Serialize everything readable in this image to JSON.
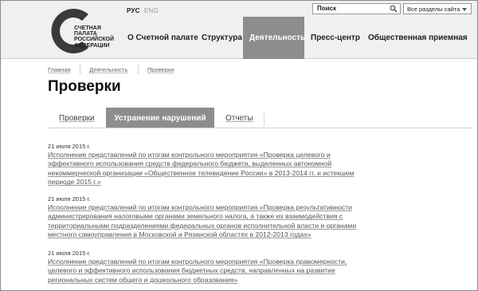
{
  "header": {
    "logo_lines": [
      "СЧЕТНАЯ",
      "ПАЛАТА",
      "РОССИЙСКОЙ",
      "ФЕДЕРАЦИИ"
    ],
    "languages": [
      {
        "label": "РУС",
        "active": true
      },
      {
        "label": "ENG",
        "active": false
      }
    ],
    "search": {
      "value": "Поиск",
      "icon": "search-icon"
    },
    "section_select": {
      "value": "Все разделы сайта",
      "icon": "chevron-down-icon"
    },
    "nav": [
      {
        "label": "О Счетной палате",
        "active": false
      },
      {
        "label": "Структура",
        "active": false
      },
      {
        "label": "Деятельность",
        "active": true
      },
      {
        "label": "Пресс-центр",
        "active": false
      },
      {
        "label": "Общественная приемная",
        "active": false
      }
    ]
  },
  "breadcrumb": [
    "Главная",
    "Деятельность",
    "Проверки"
  ],
  "page": {
    "title": "Проверки"
  },
  "tabs": [
    {
      "label": "Проверки",
      "active": false
    },
    {
      "label": "Устранение нарушений",
      "active": true
    },
    {
      "label": "Отчеты",
      "active": false
    }
  ],
  "items": [
    {
      "date": "21 июля 2015 г.",
      "lines": [
        "Исполнение представлений по итогам контрольного мероприятия «Проверка целевого и",
        "эффективного использования средств федерального бюджета, выделенных автономной",
        "некоммерческой организации «Общественное телевидение России» в 2013-2014 гг. и истекшем",
        "периоде 2015 г.»"
      ]
    },
    {
      "date": "21 июля 2015 г.",
      "lines": [
        "Исполнение представлений по итогам контрольного мероприятия «Проверка результативности",
        "администрирования налоговыми органами земельного налога, а также их взаимодействия с",
        "территориальными подразделениями федеральных органов исполнительной власти и органами",
        "местного самоуправления в Московской и Рязанской областях в 2012-2013 годах»"
      ]
    },
    {
      "date": "21 июля 2015 г.",
      "lines": [
        "Исполнение представлений по итогам контрольного мероприятия «Проверка правомерности,",
        "целевого и эффективного использования бюджетных средств, направленных на развитие",
        "региональных систем общего и дошкольного образования»"
      ]
    }
  ]
}
